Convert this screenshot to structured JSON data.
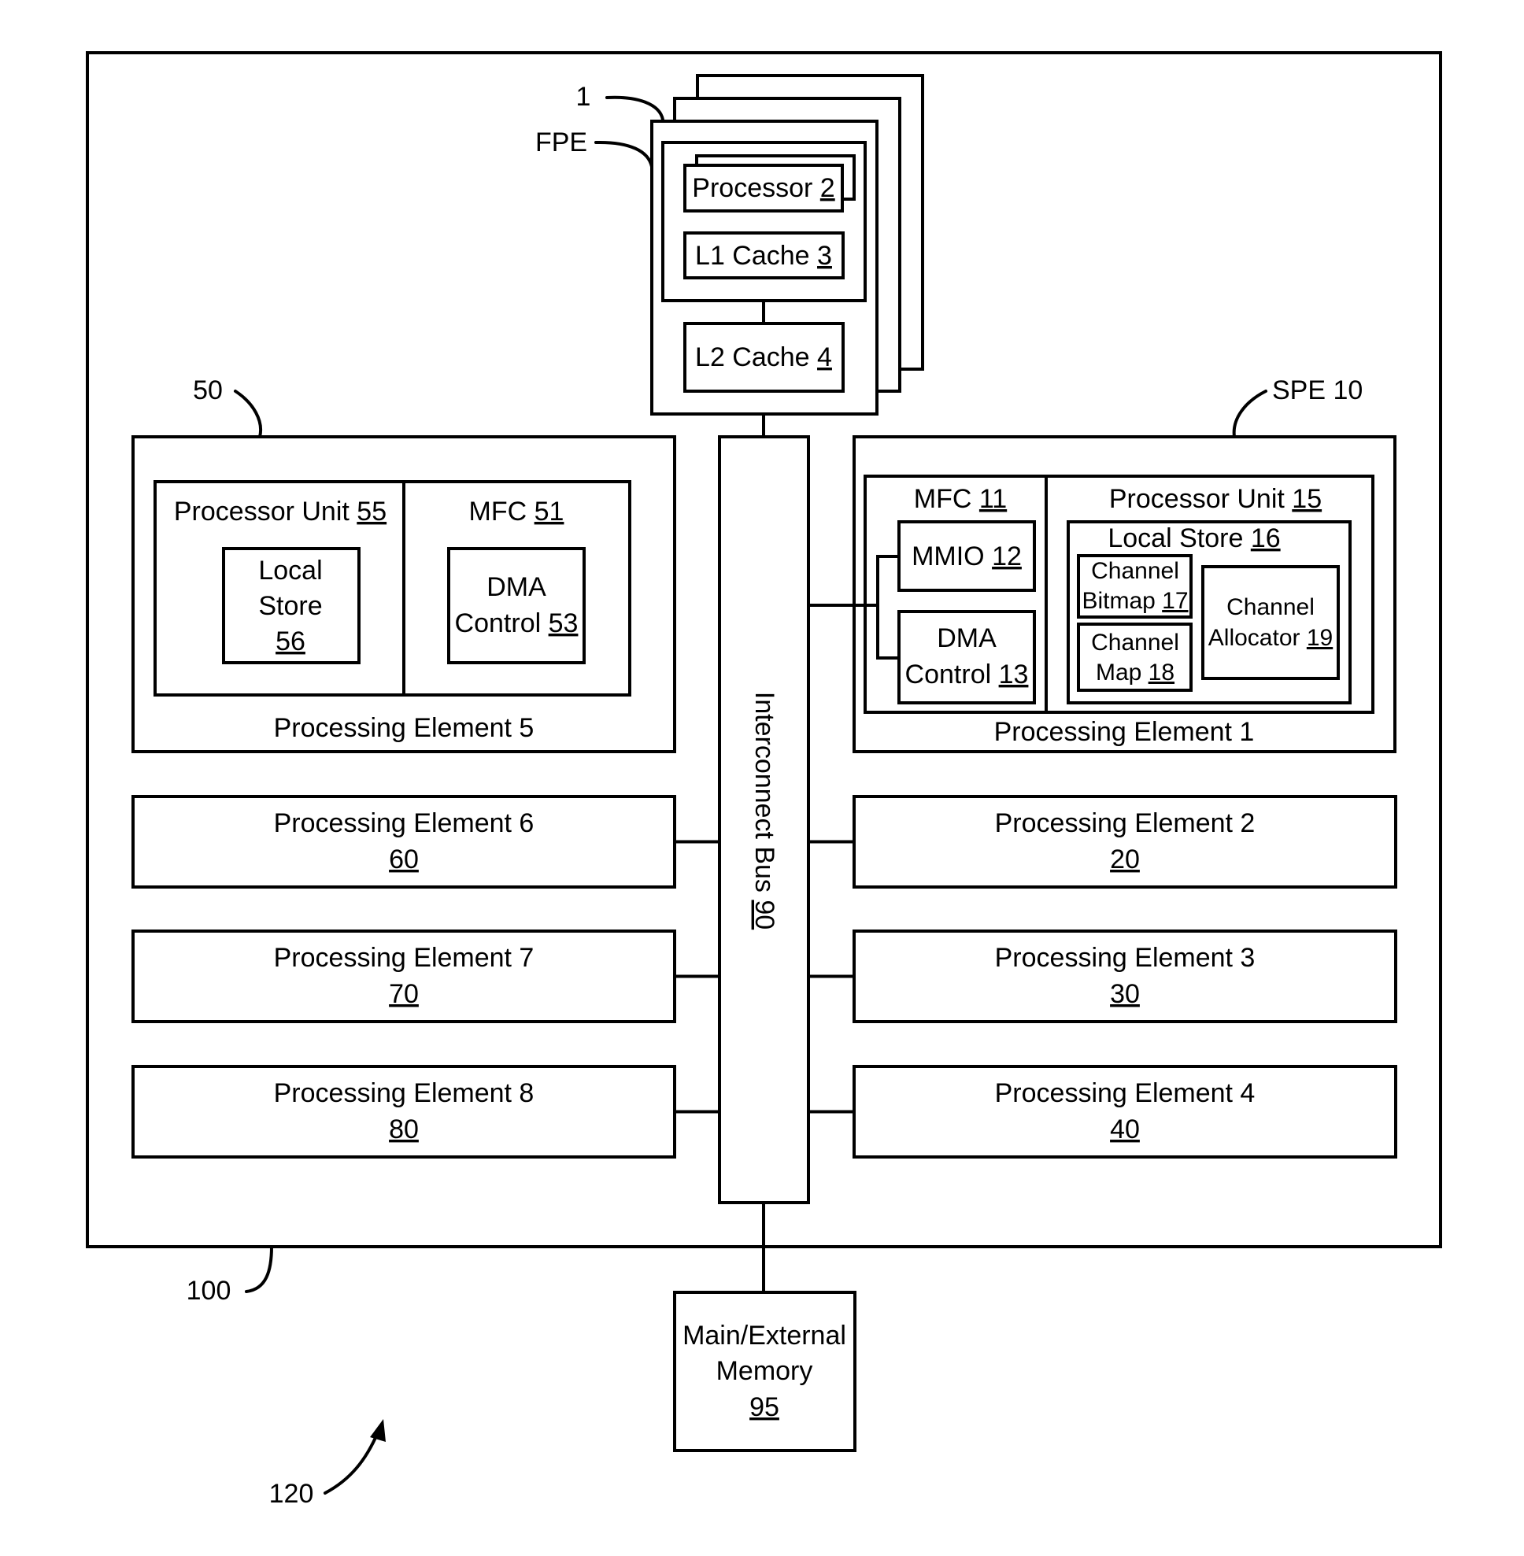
{
  "diagram": {
    "system_ref": "100",
    "figure_ref": "120",
    "fpe": {
      "ref_label": "1",
      "name_label": "FPE",
      "processor": {
        "label": "Processor",
        "ref": "2"
      },
      "l1_cache": {
        "label": "L1 Cache",
        "ref": "3"
      },
      "l2_cache": {
        "label": "L2 Cache",
        "ref": "4"
      }
    },
    "pe5": {
      "ref_label": "50",
      "title": "Processing Element 5",
      "processor_unit": {
        "label": "Processor Unit",
        "ref": "55"
      },
      "local_store": {
        "line1": "Local",
        "line2": "Store",
        "ref": "56"
      },
      "mfc": {
        "label": "MFC",
        "ref": "51"
      },
      "dma_control": {
        "line1": "DMA",
        "line2": "Control",
        "ref": "53"
      }
    },
    "pe1": {
      "ref_label": "SPE 10",
      "title": "Processing Element 1",
      "mfc": {
        "label": "MFC",
        "ref": "11"
      },
      "mmio": {
        "label": "MMIO",
        "ref": "12"
      },
      "dma_control": {
        "line1": "DMA",
        "line2": "Control",
        "ref": "13"
      },
      "processor_unit": {
        "label": "Processor Unit",
        "ref": "15"
      },
      "local_store": {
        "label": "Local Store",
        "ref": "16"
      },
      "channel_bitmap": {
        "line1": "Channel",
        "line2": "Bitmap",
        "ref": "17"
      },
      "channel_map": {
        "line1": "Channel",
        "line2": "Map",
        "ref": "18"
      },
      "channel_allocator": {
        "line1": "Channel",
        "line2": "Allocator",
        "ref": "19"
      }
    },
    "simple_elements": [
      {
        "title": "Processing Element 6",
        "ref": "60"
      },
      {
        "title": "Processing Element 7",
        "ref": "70"
      },
      {
        "title": "Processing Element 8",
        "ref": "80"
      },
      {
        "title": "Processing Element 2",
        "ref": "20"
      },
      {
        "title": "Processing Element 3",
        "ref": "30"
      },
      {
        "title": "Processing Element 4",
        "ref": "40"
      }
    ],
    "bus": {
      "label": "Interconnect Bus",
      "ref": "90"
    },
    "memory": {
      "line1": "Main/External",
      "line2": "Memory",
      "ref": "95"
    }
  }
}
